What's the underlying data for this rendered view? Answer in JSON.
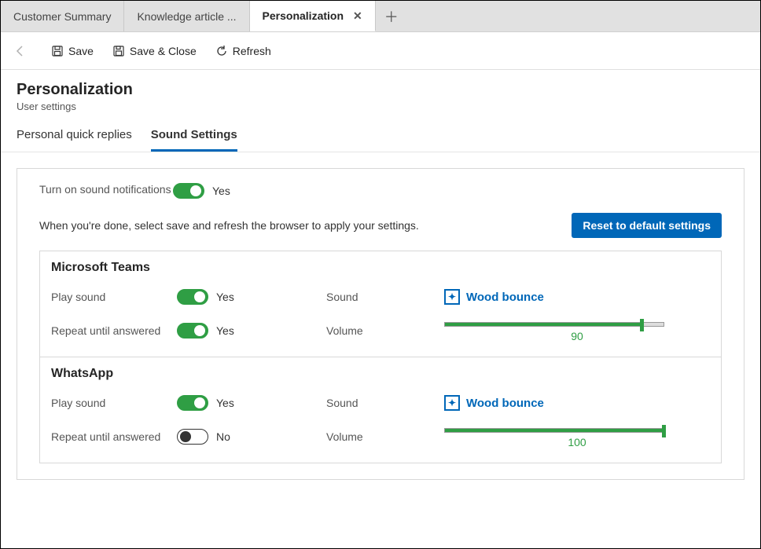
{
  "tabs": [
    {
      "label": "Customer Summary"
    },
    {
      "label": "Knowledge article ..."
    },
    {
      "label": "Personalization",
      "active": true
    }
  ],
  "toolbar": {
    "save": "Save",
    "saveClose": "Save & Close",
    "refresh": "Refresh"
  },
  "header": {
    "title": "Personalization",
    "subtitle": "User settings"
  },
  "subtabs": [
    {
      "label": "Personal quick replies",
      "active": false
    },
    {
      "label": "Sound Settings",
      "active": true
    }
  ],
  "sound": {
    "turnOnLabel": "Turn on sound notifications",
    "turnOnValue": "Yes",
    "helpText": "When you're done, select save and refresh the browser to apply your settings.",
    "resetLabel": "Reset to default settings"
  },
  "fields": {
    "playSound": "Play sound",
    "repeat": "Repeat until answered",
    "sound": "Sound",
    "volume": "Volume",
    "yes": "Yes",
    "no": "No"
  },
  "channels": [
    {
      "name": "Microsoft Teams",
      "playSound": true,
      "repeat": true,
      "sound": "Wood bounce",
      "volume": 90
    },
    {
      "name": "WhatsApp",
      "playSound": true,
      "repeat": false,
      "sound": "Wood bounce",
      "volume": 100
    }
  ]
}
